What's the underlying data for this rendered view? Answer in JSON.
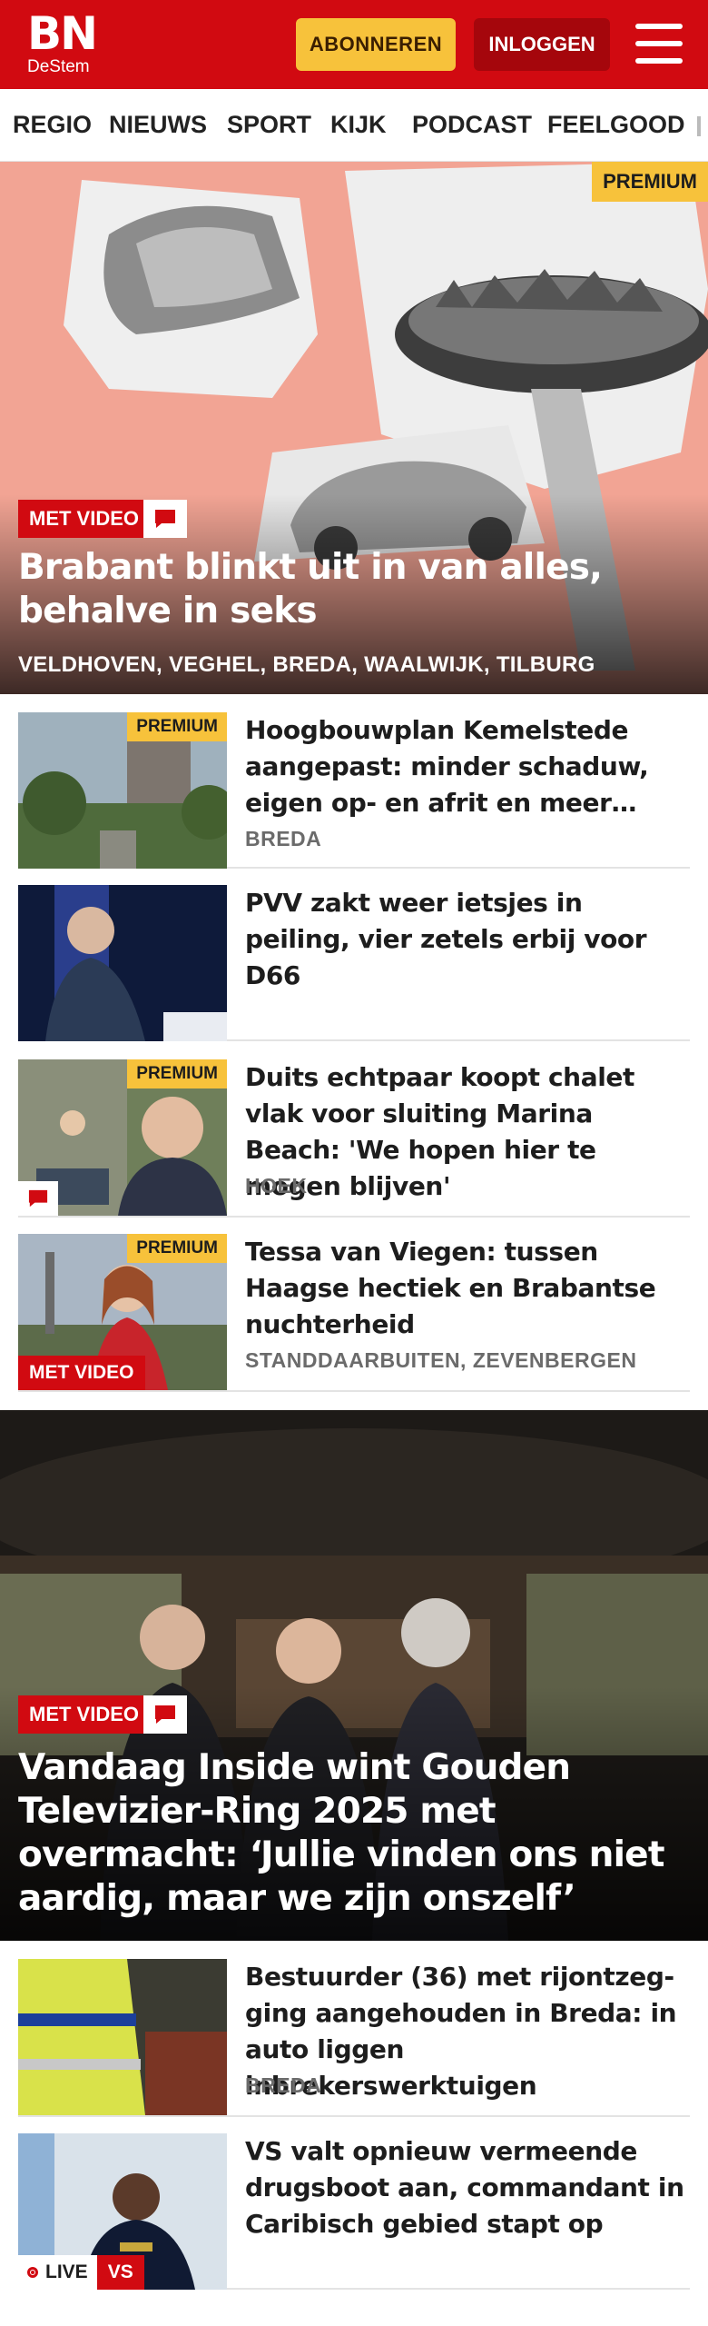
{
  "header": {
    "logo_main": "BN",
    "logo_sub": "DeStem",
    "subscribe_label": "ABONNEREN",
    "login_label": "INLOGGEN",
    "menu_icon": "hamburger-menu-icon"
  },
  "nav": {
    "items": [
      "REGIO",
      "NIEUWS",
      "SPORT",
      "KIJK",
      "PODCAST",
      "FEELGOOD"
    ]
  },
  "hero": {
    "premium": "PREMIUM",
    "video": "MET VIDEO",
    "comment_icon": "comment-icon",
    "title": "Brabant blinkt uit in van alles, behalve in seks",
    "locations": "VELDHOVEN, VEGHEL, BREDA, WAALWIJK, TILBURG"
  },
  "articles": [
    {
      "premium": "PREMIUM",
      "title": "Hoogbouwplan Kemelstede aangepast: minder schaduw, eigen op- en afrit en meer…",
      "location": "BREDA"
    },
    {
      "title": "PVV zakt weer ietsjes in peiling, vier zetels erbij voor D66"
    },
    {
      "premium": "PREMIUM",
      "title": "Duits echtpaar koopt chalet vlak voor sluiting Marina Beach: 'We hopen hier te mogen blijven'",
      "location": "HOEK"
    },
    {
      "premium": "PREMIUM",
      "video": "MET VIDEO",
      "title": "Tessa van Viegen: tussen Haagse hectiek en Brabantse nuchter­heid",
      "location": "STANDDAARBUITEN, ZEVENBERGEN"
    }
  ],
  "hero2": {
    "video": "MET VIDEO",
    "comment_icon": "comment-icon",
    "title": "Vandaag Inside wint Gouden Televizier-Ring 2025 met overmacht: ‘Jullie vinden ons niet aardig, maar we zijn onszelf’"
  },
  "articles2": [
    {
      "title": "Bestuurder (36) met rijontzeg­ging aangehouden in Breda: in auto liggen inbrekerswerktuigen",
      "location": "BREDA"
    },
    {
      "title": "VS valt opnieuw vermeende drugsboot aan, commandant in Caribisch gebied stapt op",
      "live": "LIVE",
      "live_tag": "VS"
    }
  ]
}
